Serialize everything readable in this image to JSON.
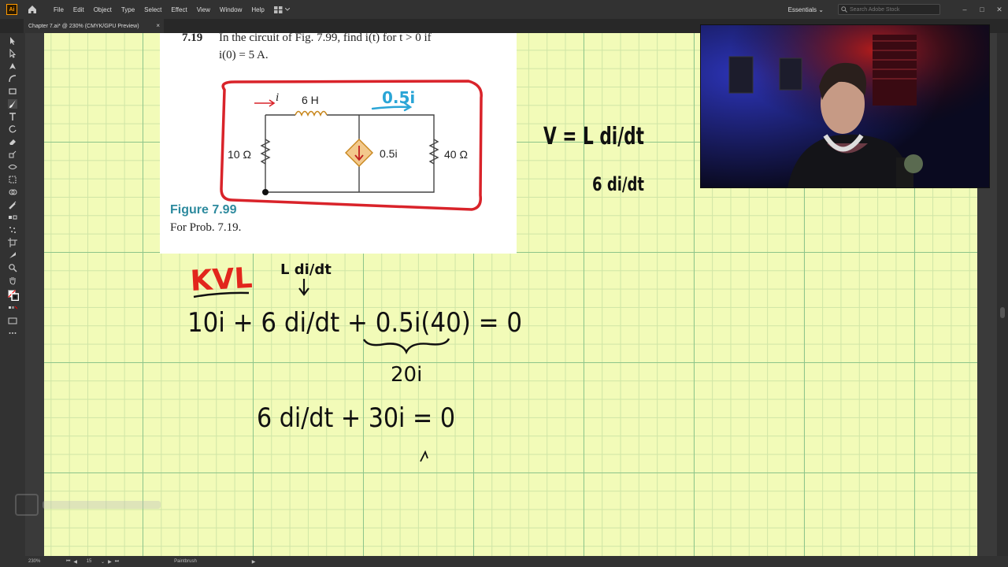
{
  "menu": {
    "app_logo": "Ai",
    "items": [
      "File",
      "Edit",
      "Object",
      "Type",
      "Select",
      "Effect",
      "View",
      "Window",
      "Help"
    ],
    "workspace": "Essentials",
    "search_placeholder": "Search Adobe Stock"
  },
  "document": {
    "tab_title": "Chapter 7.ai* @ 230% (CMYK/GPU Preview)",
    "close_symbol": "×"
  },
  "status": {
    "zoom": "230%",
    "page": "15",
    "current_tool": "Paintbrush"
  },
  "figure": {
    "problem_number": "7.19",
    "problem_text_line1": "In the circuit of Fig. 7.99, find i(t) for t > 0 if",
    "problem_text_line2": "i(0) = 5 A.",
    "caption_title": "Figure 7.99",
    "caption_sub": "For Prob. 7.19.",
    "labels": {
      "current": "i",
      "inductor": "6 H",
      "r1": "10 Ω",
      "dependent_source": "0.5i",
      "r2": "40 Ω",
      "handwritten_source": "0.5i"
    }
  },
  "handwriting": {
    "kvl_label": "KVL",
    "annotation_top": "L di/dt",
    "equation1": "10i + 6 di/dt + 0.5i(40) = 0",
    "under_brace": "20i",
    "equation2": "6 di/dt + 30i = 0",
    "side_formula_1": "V = L di/dt",
    "side_formula_2": "6 di/dt",
    "ink_color": "#111111",
    "kvl_color": "#e2261c",
    "arrow_color": "#2aa5d6"
  },
  "colors": {
    "artboard_bg": "#f2fbb8",
    "grid_major": "#8ec58a",
    "grid_minor": "#cfe5a6",
    "ui_bg": "#323232",
    "figure_title": "#2d8a9e",
    "circuit_outline": "#d9232a"
  },
  "icons": {
    "toolbar": [
      "selection-icon",
      "direct-selection-icon",
      "pen-icon",
      "curvature-icon",
      "rectangle-icon",
      "paintbrush-icon",
      "type-icon",
      "rotate-icon",
      "eraser-icon",
      "scale-icon",
      "width-icon",
      "free-transform-icon",
      "shape-builder-icon",
      "eyedropper-icon",
      "blend-icon",
      "symbol-sprayer-icon",
      "artboard-icon",
      "slice-icon",
      "hand-icon",
      "zoom-icon",
      "fill-stroke-icon",
      "drawing-modes-icon",
      "screen-mode-icon",
      "edit-toolbar-icon"
    ]
  }
}
